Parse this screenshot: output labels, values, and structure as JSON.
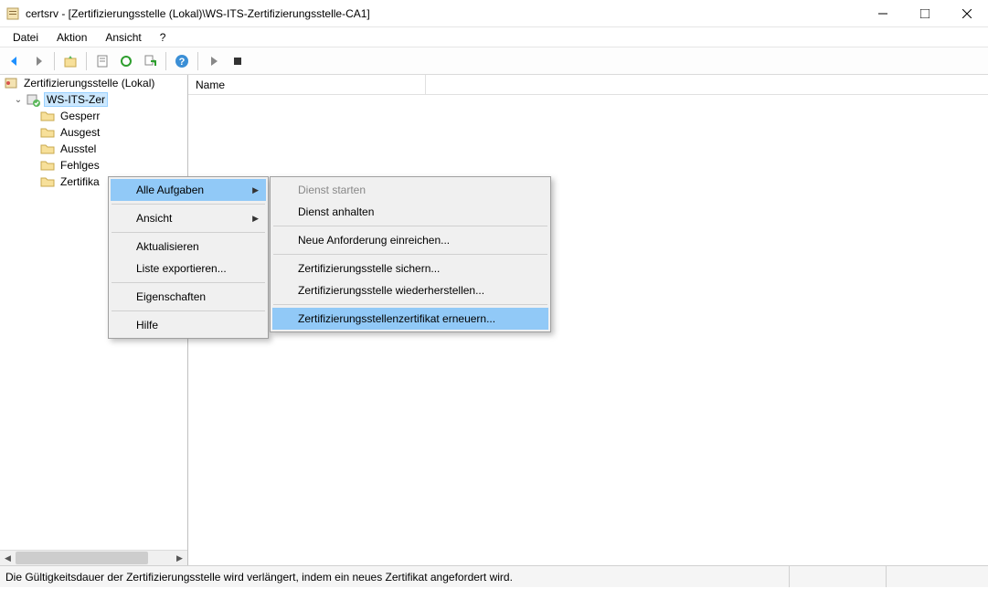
{
  "window": {
    "title": "certsrv - [Zertifizierungsstelle (Lokal)\\WS-ITS-Zertifizierungsstelle-CA1]"
  },
  "menubar": {
    "file": "Datei",
    "action": "Aktion",
    "view": "Ansicht",
    "help": "?"
  },
  "tree": {
    "root": "Zertifizierungsstelle (Lokal)",
    "ca": "WS-ITS-Zer",
    "children": {
      "revoked": "Gesperr",
      "issued": "Ausgest",
      "pending": "Ausstel",
      "failed": "Fehlges",
      "templates": "Zertifika"
    }
  },
  "list": {
    "col_name": "Name"
  },
  "ctx1": {
    "all_tasks": "Alle Aufgaben",
    "view": "Ansicht",
    "refresh": "Aktualisieren",
    "export_list": "Liste exportieren...",
    "properties": "Eigenschaften",
    "help": "Hilfe"
  },
  "ctx2": {
    "start_service": "Dienst starten",
    "stop_service": "Dienst anhalten",
    "submit_new": "Neue Anforderung einreichen...",
    "backup_ca": "Zertifizierungsstelle sichern...",
    "restore_ca": "Zertifizierungsstelle wiederherstellen...",
    "renew_cert": "Zertifizierungsstellenzertifikat erneuern..."
  },
  "statusbar": {
    "text": "Die Gültigkeitsdauer der Zertifizierungsstelle wird verlängert, indem ein neues Zertifikat angefordert wird."
  }
}
